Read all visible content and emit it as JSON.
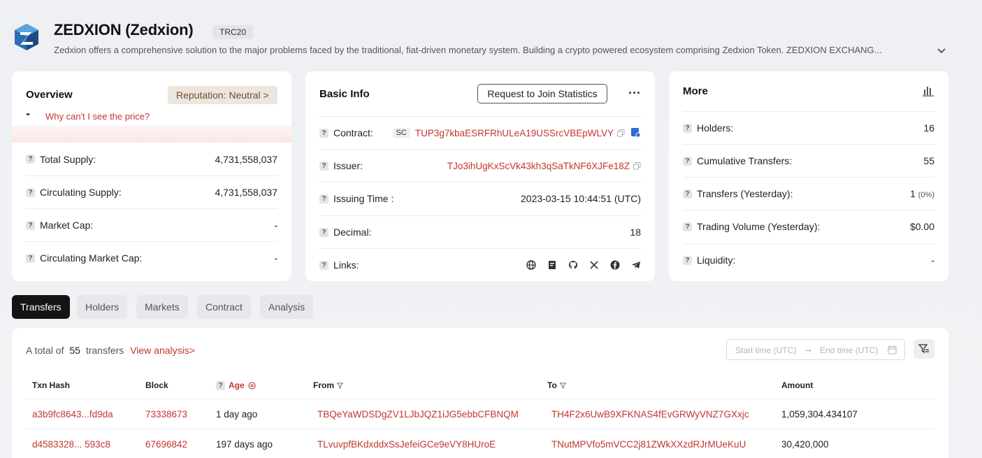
{
  "header": {
    "title": "ZEDXION (Zedxion)",
    "token_standard": "TRC20",
    "description": "Zedxion offers a comprehensive solution to the major problems faced by the traditional, fiat-driven monetary system. Building a crypto powered ecosystem comprising Zedxion Token. ZEDXION EXCHANG..."
  },
  "overview": {
    "title": "Overview",
    "reputation": "Reputation: Neutral >",
    "price": "-",
    "price_link": "Why can't I see the price?",
    "rows": [
      {
        "label": "Total Supply:",
        "value": "4,731,558,037"
      },
      {
        "label": "Circulating Supply:",
        "value": "4,731,558,037"
      },
      {
        "label": "Market Cap:",
        "value": "-"
      },
      {
        "label": "Circulating Market Cap:",
        "value": "-"
      }
    ]
  },
  "basic_info": {
    "title": "Basic Info",
    "join_button": "Request to Join Statistics",
    "more_menu": "...",
    "contract_label": "Contract:",
    "contract_badge": "SC",
    "contract_value": "TUP3g7kbaESRFRhULeA19USSrcVBEpWLVY",
    "issuer_label": "Issuer:",
    "issuer_value": "TJo3ihUgKxScVk43kh3qSaTkNF6XJFe18Z",
    "issuing_time_label": "Issuing Time :",
    "issuing_time_value": "2023-03-15 10:44:51 (UTC)",
    "decimal_label": "Decimal:",
    "decimal_value": "18",
    "links_label": "Links:",
    "links": [
      "globe-icon",
      "whitepaper-icon",
      "github-icon",
      "x-icon",
      "facebook-icon",
      "telegram-icon"
    ]
  },
  "more": {
    "title": "More",
    "holders_label": "Holders:",
    "holders_value": "16",
    "cumulative_label": "Cumulative Transfers:",
    "cumulative_value": "55",
    "yesterday_label": "Transfers (Yesterday):",
    "yesterday_value": "1",
    "yesterday_pct": "(0%)",
    "volume_label": "Trading Volume (Yesterday):",
    "volume_value": "$0.00",
    "liquidity_label": "Liquidity:",
    "liquidity_value": "-"
  },
  "tabs": [
    "Transfers",
    "Holders",
    "Markets",
    "Contract",
    "Analysis"
  ],
  "transfers": {
    "total_prefix": "A total of",
    "total_count": "55",
    "total_suffix": "transfers",
    "view_analysis": "View analysis>",
    "start_placeholder": "Start time (UTC)",
    "end_placeholder": "End time (UTC)",
    "arrow": "→",
    "columns": {
      "hash": "Txn Hash",
      "block": "Block",
      "age": "Age",
      "from": "From",
      "to": "To",
      "amount": "Amount"
    },
    "rows": [
      {
        "hash": "a3b9fc8643...fd9da",
        "block": "73338673",
        "age": "1 day ago",
        "from": "TBQeYaWDSDgZV1LJbJQZ1iJG5ebbCFBNQM",
        "to": "TH4F2x6UwB9XFKNAS4fEvGRWyVNZ7GXxjc",
        "amount": "1,059,304.434107"
      },
      {
        "hash": "d4583328... 593c8",
        "block": "67696842",
        "age": "197 days ago",
        "from": "TLvuvpfBKdxddxSsJefeiGCe9eVY8HUroE",
        "to": "TNutMPVfo5mVCC2j81ZWkXXzdRJrMUeKuU",
        "amount": "30,420,000"
      }
    ]
  },
  "colors": {
    "accent": "#c23631",
    "tab_active": "#141414"
  }
}
